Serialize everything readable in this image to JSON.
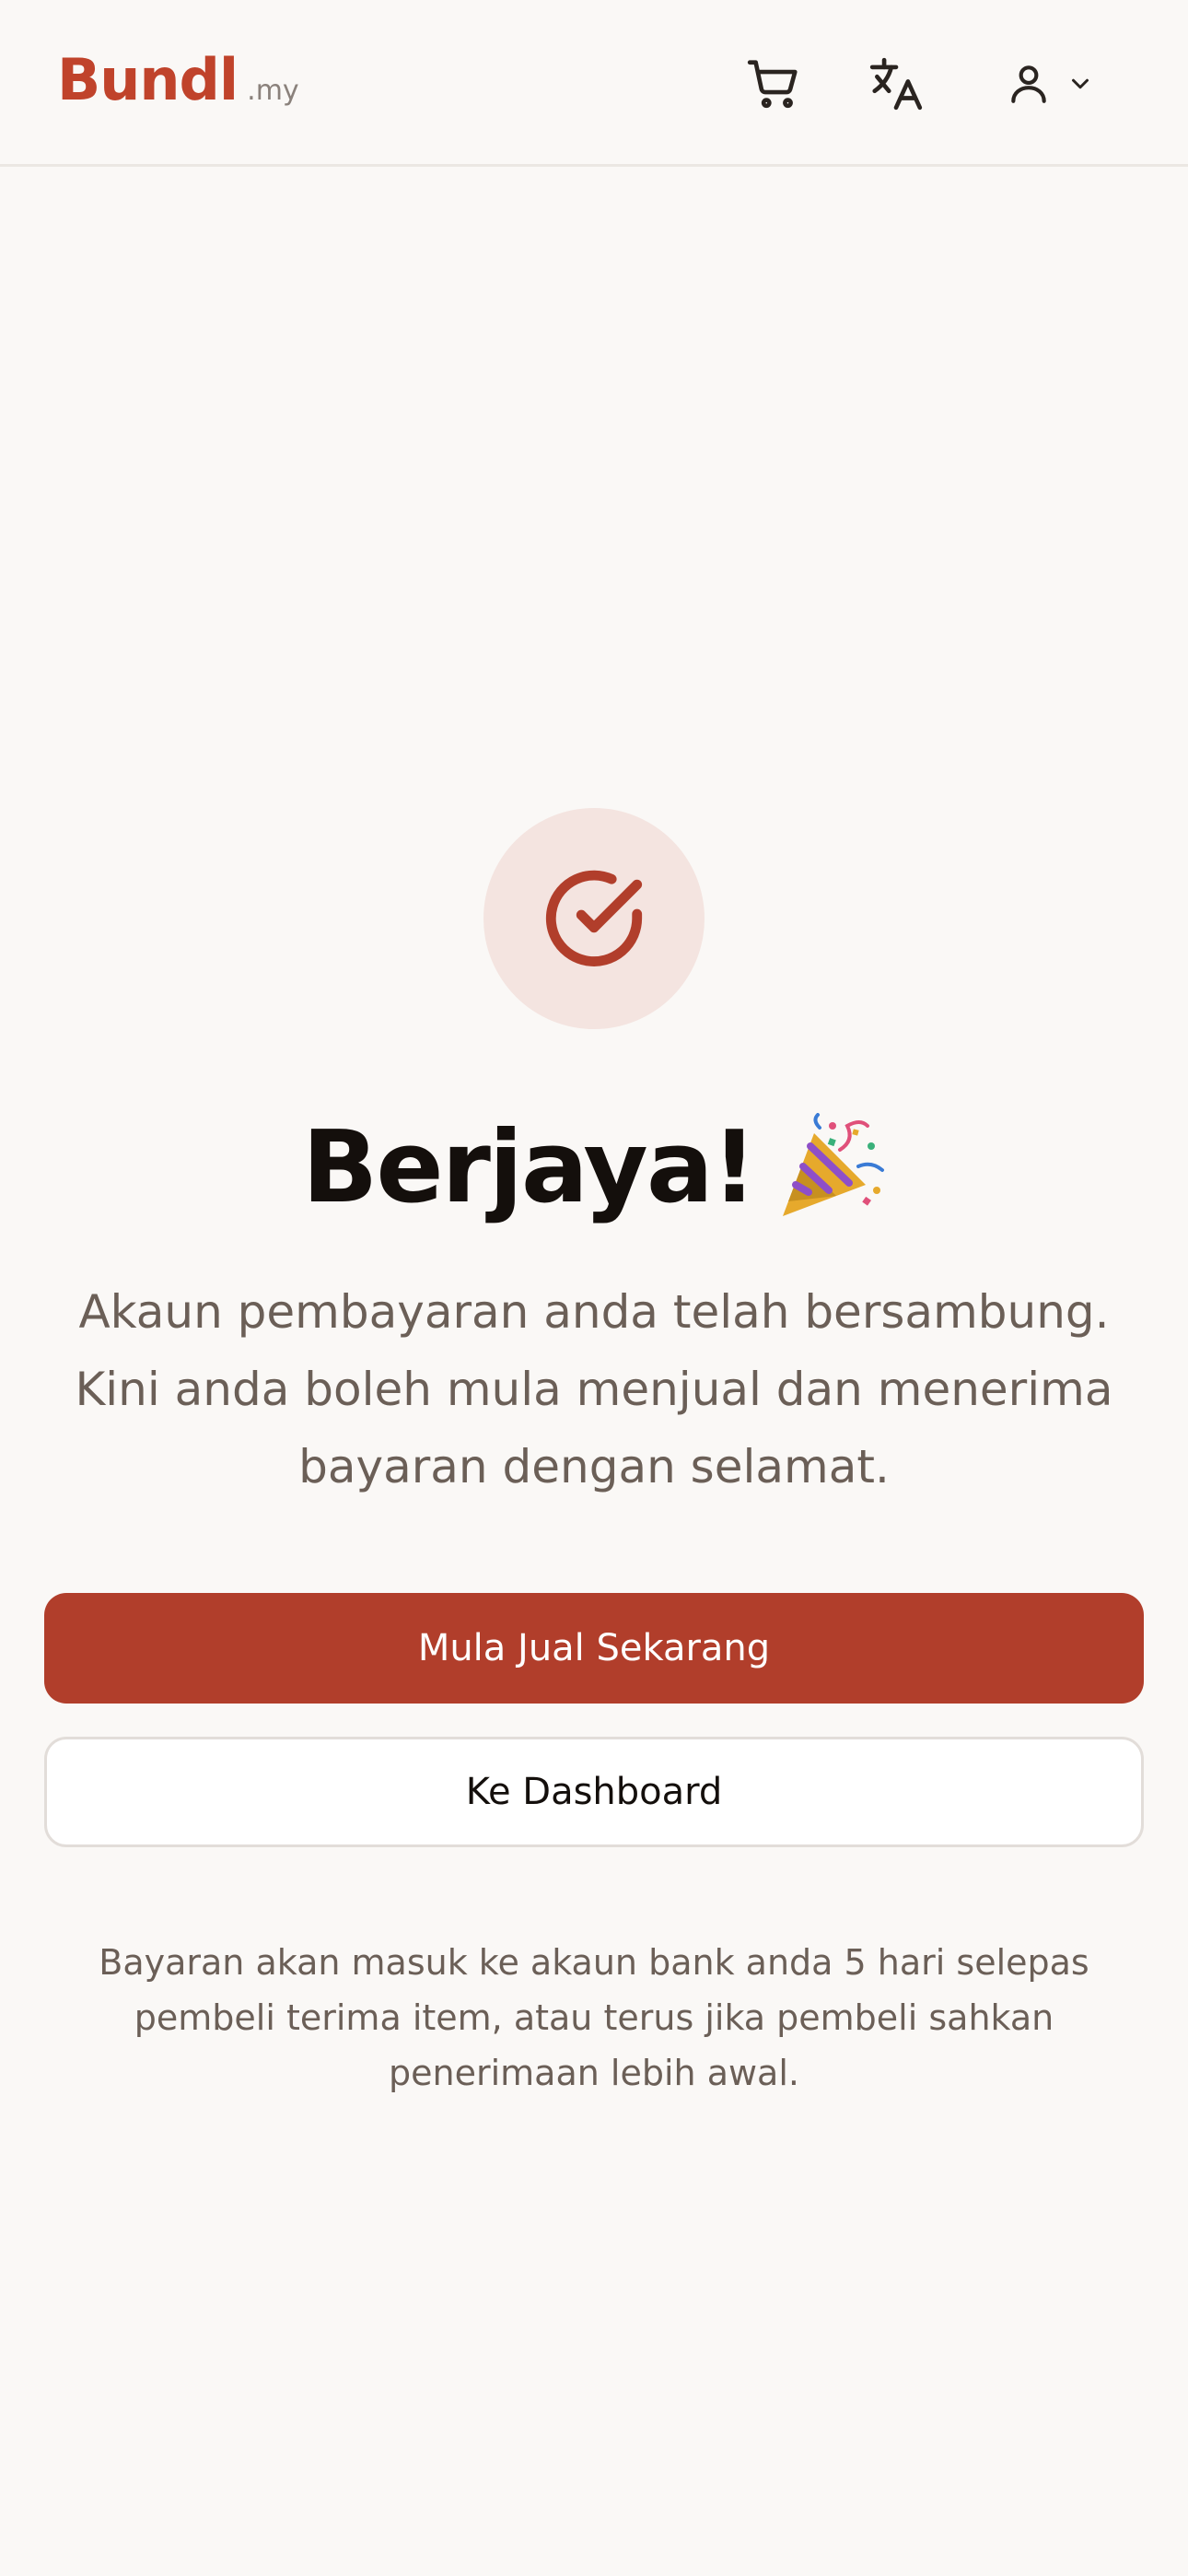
{
  "header": {
    "logo_main": "Bundl",
    "logo_suffix": ".my",
    "icons": {
      "cart": "shopping-cart-icon",
      "translate": "translate-icon",
      "account": "user-icon",
      "dropdown": "chevron-down-icon"
    }
  },
  "main": {
    "status_icon": "check-circle-icon",
    "title": "Berjaya!",
    "title_emoji": "party-popper-icon",
    "description": "Akaun pembayaran anda telah bersambung. Kini anda boleh mula menjual dan menerima bayaran dengan selamat.",
    "primary_button": "Mula Jual Sekarang",
    "secondary_button": "Ke Dashboard",
    "note": "Bayaran akan masuk ke akaun bank anda 5 hari selepas pembeli terima item, atau terus jika pembeli sahkan penerimaan lebih awal."
  },
  "colors": {
    "brand": "#c0432b",
    "primary_button": "#b13e2b",
    "icon_circle_bg": "#f4e4e0",
    "page_bg": "#faf8f6",
    "muted_text": "#6b5f57"
  }
}
